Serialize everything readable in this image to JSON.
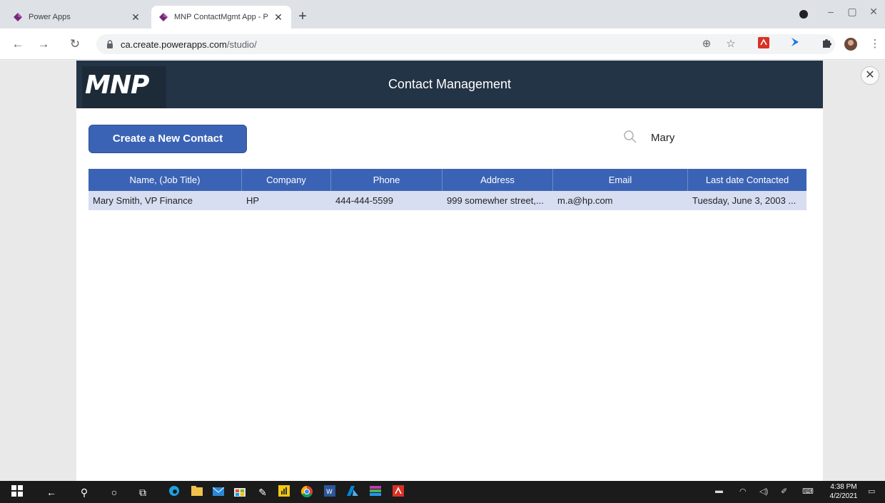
{
  "browser": {
    "tabs": [
      {
        "title": "Power Apps",
        "close": "✕"
      },
      {
        "title": "MNP ContactMgmt App - Pow",
        "close": "✕"
      }
    ],
    "new_tab": "+",
    "url_host": "ca.create.powerapps.com",
    "url_path": "/studio/",
    "window_controls": {
      "minimize": "–",
      "maximize": "▢",
      "close": "✕"
    }
  },
  "studio": {
    "close": "✕"
  },
  "app": {
    "logo_text": "MNP",
    "title": "Contact Management",
    "create_button": "Create a New Contact",
    "search_value": "Mary",
    "columns": [
      "Name, (Job Title)",
      "Company",
      "Phone",
      "Address",
      "Email",
      "Last date Contacted"
    ],
    "rows": [
      {
        "name": "Mary Smith, VP Finance",
        "company": "HP",
        "phone": "444-444-5599",
        "address": "999 somewher street,...",
        "email": "m.a@hp.com",
        "last_contacted": "Tuesday, June 3, 2003 ..."
      }
    ]
  },
  "taskbar": {
    "time": "4:38 PM",
    "date": "4/2/2021"
  },
  "colors": {
    "header_bg": "#243447",
    "accent": "#3b63b5",
    "row_bg": "#d7def2"
  }
}
